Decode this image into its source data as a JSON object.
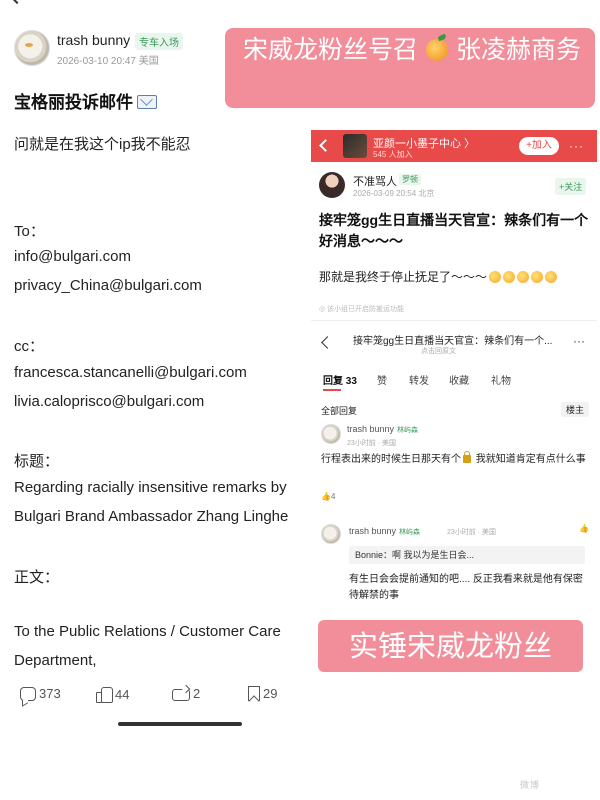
{
  "post": {
    "username": "trash bunny",
    "user_tag": "专车入场",
    "meta": "2026-03-10 20:47  美国",
    "title": "宝格丽投诉邮件",
    "lines": [
      "问就是在我这个ip我不能忍",
      "To：",
      "info@bulgari.com",
      "privacy_China@bulgari.com",
      "cc：",
      "francesca.stancanelli@bulgari.com",
      "livia.caloprisco@bulgari.com",
      "标题：",
      "Regarding racially insensitive remarks by",
      "Bulgari Brand Ambassador Zhang Linghe",
      "正文：",
      "To the Public Relations / Customer Care",
      "Department,"
    ],
    "actions": {
      "comments": "373",
      "likes": "44",
      "reposts": "2",
      "saves": "29"
    }
  },
  "banner": {
    "text_a": "宋威龙粉丝号召",
    "text_b": "张凌赫商务"
  },
  "screenshot": {
    "header": {
      "title": "亚颜一小墨子中心 〉",
      "sub": "545 人加入",
      "join": "+加入",
      "more": "···"
    },
    "post2": {
      "name": "不准骂人",
      "tag": "罗顿",
      "meta": "2026-03-09 20:54  北京",
      "follow": "+关注",
      "title": "接牢笼gg生日直播当天官宣：辣条们有一个好消息～～～",
      "body": "那就是我终于停止抚足了～～～",
      "note": "◎ 该小组已开启防搬运功能"
    },
    "subheader": {
      "title": "接牢笼gg生日直播当天官宣：辣条们有一个...",
      "sub": "点击回原文",
      "more": "···"
    },
    "tabs": [
      "回复 33",
      "赞",
      "转发",
      "收藏",
      "礼物"
    ],
    "all_replies": "全部回复",
    "floor": "楼主",
    "comment1": {
      "name": "trash bunny",
      "tag": "林屿森",
      "meta": "23小时前 · 美国",
      "text_a": "行程表出来的时候生日那天有个",
      "text_b": " 我就知道肯定有点什么事",
      "likes": "4"
    },
    "comment2": {
      "name": "trash bunny",
      "tag": "林屿森",
      "meta": "23小时前 · 美国",
      "quote": "Bonnie：啊 我以为是生日会...",
      "text": "有生日会会提前通知的吧.... 反正我看来就是他有保密待解禁的事"
    }
  },
  "stamp": "实锤宋威龙粉丝",
  "watermark": "微博"
}
